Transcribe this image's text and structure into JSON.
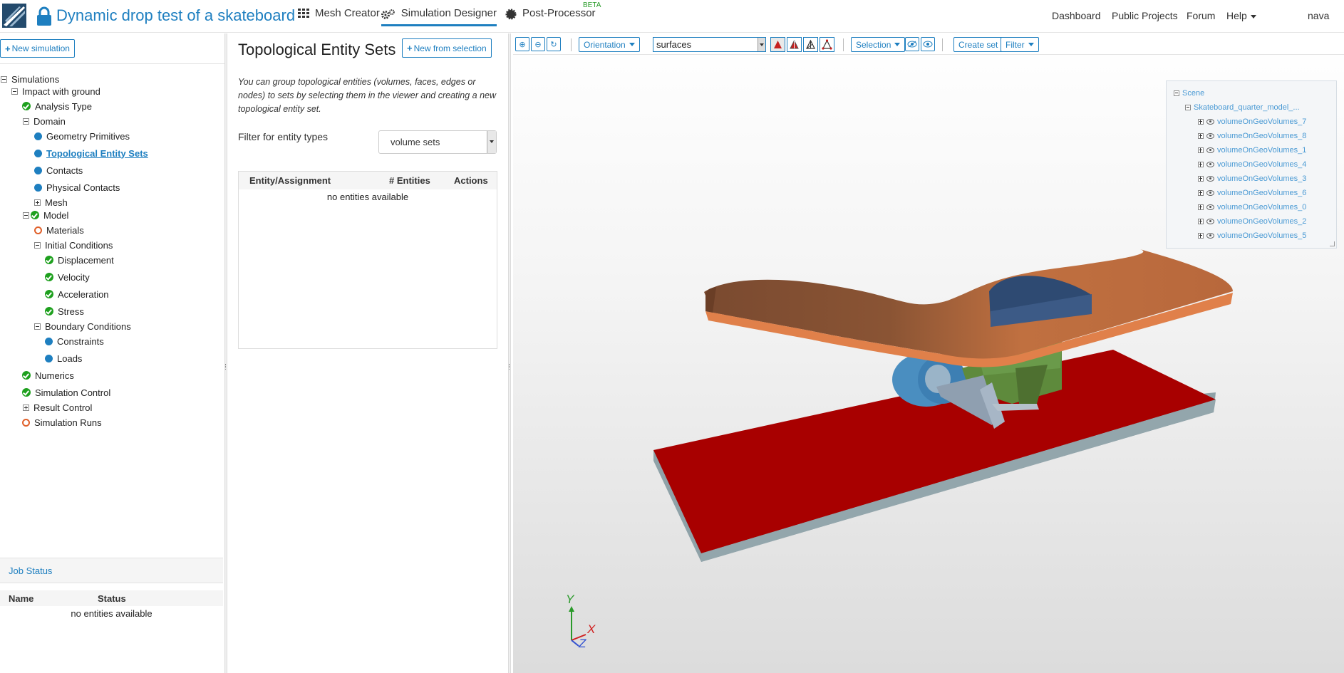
{
  "topnav": {
    "project_title": "Dynamic drop test of a skateboard",
    "tabs": [
      {
        "label": "Mesh Creator",
        "icon": "grid-icon"
      },
      {
        "label": "Simulation Designer",
        "icon": "gears-icon"
      },
      {
        "label": "Post-Processor",
        "icon": "gear-icon",
        "badge": "BETA"
      }
    ],
    "right": {
      "dashboard": "Dashboard",
      "public_projects": "Public Projects",
      "forum": "Forum",
      "help": "Help",
      "user": "nava"
    }
  },
  "sidebar": {
    "new_simulation_label": "New simulation",
    "tree": {
      "simulations": "Simulations",
      "impact": "Impact with ground",
      "analysis_type": "Analysis Type",
      "domain": "Domain",
      "geometry_primitives": "Geometry Primitives",
      "topological_entity_sets": "Topological Entity Sets",
      "contacts": "Contacts",
      "physical_contacts": "Physical Contacts",
      "mesh": "Mesh",
      "model": "Model",
      "materials": "Materials",
      "initial_conditions": "Initial Conditions",
      "displacement": "Displacement",
      "velocity": "Velocity",
      "acceleration": "Acceleration",
      "stress": "Stress",
      "boundary_conditions": "Boundary Conditions",
      "constraints": "Constraints",
      "loads": "Loads",
      "numerics": "Numerics",
      "simulation_control": "Simulation Control",
      "result_control": "Result Control",
      "simulation_runs": "Simulation Runs"
    }
  },
  "job_status": {
    "title": "Job Status",
    "columns": [
      "Name",
      "Status"
    ],
    "empty": "no entities available"
  },
  "panel": {
    "title": "Topological Entity Sets",
    "new_from_selection": "New from selection",
    "description": "You can group topological entities (volumes, faces, edges or nodes) to sets by selecting them in the viewer and creating a new topological entity set.",
    "filter_label": "Filter for entity types",
    "filter_value": "volume sets",
    "table_columns": [
      "Entity/Assignment",
      "# Entities",
      "Actions"
    ],
    "table_empty": "no entities available"
  },
  "viewer": {
    "orientation_label": "Orientation",
    "surface_select_value": "surfaces",
    "selection_label": "Selection",
    "create_set_label": "Create set",
    "filter_label": "Filter",
    "scene": {
      "root": "Scene",
      "model": "Skateboard_quarter_model_...",
      "volumes": [
        "volumeOnGeoVolumes_7",
        "volumeOnGeoVolumes_8",
        "volumeOnGeoVolumes_1",
        "volumeOnGeoVolumes_4",
        "volumeOnGeoVolumes_3",
        "volumeOnGeoVolumes_6",
        "volumeOnGeoVolumes_0",
        "volumeOnGeoVolumes_2",
        "volumeOnGeoVolumes_5"
      ]
    },
    "axes": {
      "x": "X",
      "y": "Y",
      "z": "Z"
    },
    "colors": {
      "deck": "#c8703f",
      "ground": "#a80000",
      "truck": "#6a9a4a",
      "wheel": "#4a8ec0",
      "insert": "#3c5a86",
      "accent": "#1e7fc0"
    }
  }
}
